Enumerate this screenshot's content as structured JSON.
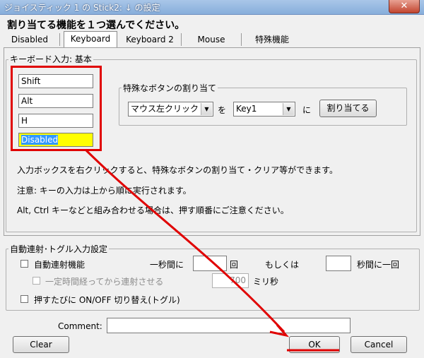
{
  "window": {
    "title": "ジョイスティック 1 の Stick2: ↓ の設定",
    "close_glyph": "✕"
  },
  "heading": "割り当てる機能を１つ選んでください。",
  "tabs": [
    "Disabled",
    "Keyboard",
    "Keyboard 2",
    "Mouse",
    "特殊機能"
  ],
  "keyboard": {
    "group_label": "キーボード入力: 基本",
    "inputs": [
      "Shift",
      "Alt",
      "H",
      "Disabled"
    ],
    "highlight_color": "#ffff00"
  },
  "special": {
    "group_label": "特殊なボタンの割り当て",
    "action_value": "マウス左クリック",
    "wo": "を",
    "key_value": "Key1",
    "ni": "に",
    "assign_label": "割り当てる"
  },
  "notes": [
    "入力ボックスを右クリックすると、特殊なボタンの割り当て・クリア等ができます。",
    "注意: キーの入力は上から順に実行されます。",
    "Alt, Ctrl キーなどと組み合わせる場合は、押す順番にご注意ください。"
  ],
  "auto": {
    "group_label": "自動連射･トグル入力設定",
    "rapid_label": "自動連射機能",
    "per_second": "一秒間に",
    "times": "回",
    "or": "もしくは",
    "once_per": "秒間に一回",
    "delay_label": "一定時間経ってから連射させる",
    "delay_value": "700",
    "ms": "ミリ秒",
    "toggle_label": "押すたびに ON/OFF 切り替え(トグル)"
  },
  "comment_label": "Comment:",
  "buttons": {
    "clear": "Clear",
    "ok": "OK",
    "cancel": "Cancel"
  },
  "annotation_color": "#e00000"
}
